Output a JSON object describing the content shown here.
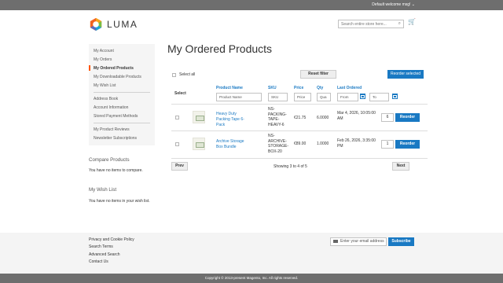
{
  "topbar": {
    "welcome": "Default welcome msg! ⌄"
  },
  "header": {
    "logo_text": "LUMA",
    "search_placeholder": "Search entire store here...",
    "search_icon": "search-icon",
    "cart_icon": "cart-icon",
    "cart_glyph": "🛒",
    "search_glyph": "⌕"
  },
  "sidebar": {
    "items_group1": [
      "My Account",
      "My Orders",
      "My Ordered Products",
      "My Downloadable Products",
      "My Wish List"
    ],
    "items_group2": [
      "Address Book",
      "Account Information",
      "Stored Payment Methods"
    ],
    "items_group3": [
      "My Product Reviews",
      "Newsletter Subscriptions"
    ],
    "active": "My Ordered Products"
  },
  "compare": {
    "title": "Compare Products",
    "text": "You have no items to compare."
  },
  "wishlist": {
    "title": "My Wish List",
    "text": "You have no items in your wish list."
  },
  "main": {
    "title": "My Ordered Products",
    "select_all": "Select all",
    "reset_filter": "Reset filter",
    "reorder_selected": "Reorder selected",
    "columns": {
      "select": "Select",
      "product_name": "Product Name",
      "sku": "SKU",
      "price": "Price",
      "qty": "Qty",
      "last_ordered": "Last Ordered"
    },
    "filters": {
      "product_name": "Product Name",
      "sku": "SKU",
      "price": "Price",
      "qty": "Qua",
      "from": "From",
      "to": "To"
    },
    "rows": [
      {
        "name": "Heavy Duty Packing Tape 6-Pack",
        "sku": "NS-PACKING-TAPE-HEAVY-6",
        "price": "€21.75",
        "qty": "6.0000",
        "last_ordered": "Mar 4, 2026, 10:05:00 AM",
        "reorder_qty": "6",
        "button": "Reorder"
      },
      {
        "name": "Archive Storage Box Bundle",
        "sku": "NS-ARCHIVE-STORAGE-BOX-20",
        "price": "€89.00",
        "qty": "1.0000",
        "last_ordered": "Feb 26, 2026, 3:35:00 PM",
        "reorder_qty": "1",
        "button": "Reorder"
      }
    ],
    "pager": {
      "prev": "Prev",
      "next": "Next",
      "status": "Showing 3 to 4 of 5"
    }
  },
  "footer": {
    "links": [
      "Privacy and Cookie Policy",
      "Search Terms",
      "Advanced Search",
      "Contact Us"
    ],
    "newsletter_placeholder": "Enter your email address",
    "subscribe": "Subscribe",
    "copyright": "Copyright © 2013-present Magento, Inc. All rights reserved."
  },
  "colors": {
    "accent": "#1979c3",
    "active_marker": "#ff5501",
    "topbar": "#6e6e6e"
  }
}
